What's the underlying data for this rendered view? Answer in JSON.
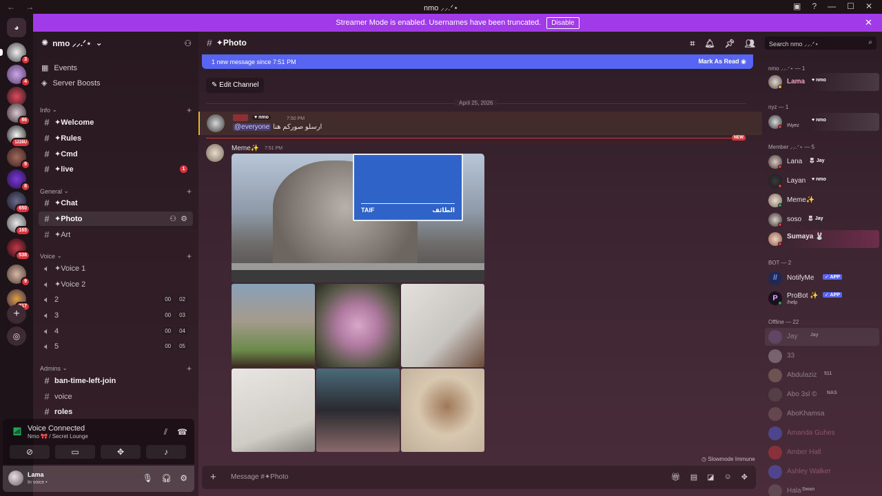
{
  "window": {
    "title": "nmo ⸝⸝.ᐟ⋆",
    "nav_arrows": "← →"
  },
  "streamer_banner": {
    "text": "Streamer Mode is enabled. Usernames have been truncated.",
    "button": "Disable"
  },
  "guilds": {
    "badges": [
      "3",
      "4",
      "86",
      "1228U",
      "9",
      "8",
      "650",
      "165",
      "538",
      "9",
      "217"
    ]
  },
  "server": {
    "name": "nmo ⸝⸝.ᐟ⋆",
    "top_items": [
      {
        "label": "Events"
      },
      {
        "label": "Server Boosts"
      }
    ],
    "categories": [
      {
        "name": "Info",
        "channels": [
          {
            "name": "✦Welcome"
          },
          {
            "name": "✦Rules"
          },
          {
            "name": "✦Cmd"
          },
          {
            "name": "✦live",
            "mention": "1"
          }
        ]
      },
      {
        "name": "General",
        "channels": [
          {
            "name": "✦Chat"
          },
          {
            "name": "✦Photo"
          },
          {
            "name": "✦Art"
          }
        ]
      },
      {
        "name": "Voice",
        "channels": [
          {
            "name": "✦Voice 1"
          },
          {
            "name": "✦Voice 2"
          },
          {
            "name": "2",
            "a": "00",
            "b": "02"
          },
          {
            "name": "3",
            "a": "00",
            "b": "03"
          },
          {
            "name": "4",
            "a": "00",
            "b": "04"
          },
          {
            "name": "5",
            "a": "00",
            "b": "05"
          }
        ]
      },
      {
        "name": "Admins",
        "channels": [
          {
            "name": "ban-time-left-join"
          },
          {
            "name": "voice"
          },
          {
            "name": "roles"
          }
        ]
      }
    ]
  },
  "voice_panel": {
    "title": "Voice Connected",
    "subtitle": "Nmo 🎀 / Secret Lounge"
  },
  "user_panel": {
    "name": "Lama",
    "status": "In voice •"
  },
  "channel": {
    "name": "✦Photo",
    "new_messages": "1 new message since 7:51 PM",
    "mark_read": "Mark As Read",
    "edit_channel": "Edit Channel",
    "date_divider": "April 25, 2026",
    "new_label": "NEW",
    "slowmode": "Slowmode Immune",
    "composer_placeholder": "Message #✦Photo"
  },
  "messages": [
    {
      "tag": "nmo",
      "time": "7:50 PM",
      "mention": "@everyone",
      "text": "ارسلو صوركم هنا"
    },
    {
      "author": "Meme✨",
      "time": "7:51 PM",
      "sign_left": "TAIF",
      "sign_right": "الطائف"
    }
  ],
  "search": {
    "placeholder": "Search nmo ⸝⸝.ᐟ⋆"
  },
  "member_groups": [
    {
      "label": "nmo ⸝⸝.ᐟ⋆ — 1"
    },
    {
      "label": "nyz — 1"
    },
    {
      "label": "Member ⸝⸝.ᐟ⋆ — 5"
    },
    {
      "label": "BOT — 2"
    },
    {
      "label": "Offline — 22"
    }
  ],
  "members": [
    {
      "name": "Lama",
      "tag": "nmo"
    },
    {
      "name": "",
      "tag": "nmo",
      "sub": "INyez"
    },
    {
      "name": "Lana",
      "tag": "Jay"
    },
    {
      "name": "Layan",
      "tag": "nmo"
    },
    {
      "name": "Meme✨",
      "tag": ""
    },
    {
      "name": "soso",
      "tag": "Jay"
    },
    {
      "name": "Sumaya 🐰",
      "tag": ""
    },
    {
      "name": "NotifyMe",
      "tag": "✓ APP"
    },
    {
      "name": "ProBot ✨",
      "tag": "✓ APP",
      "sub": "/help"
    },
    {
      "name": "Jay",
      "tag": "Jay"
    },
    {
      "name": "33",
      "tag": ""
    },
    {
      "name": "Abdulaziz",
      "tag": "511"
    },
    {
      "name": "Abo 3sl ©",
      "tag": "NAS"
    },
    {
      "name": "AboKhamsa",
      "tag": ""
    },
    {
      "name": "Amanda Guhes",
      "tag": ""
    },
    {
      "name": "Amber Hall",
      "tag": ""
    },
    {
      "name": "Ashley Walker",
      "tag": ""
    },
    {
      "name": "Hala",
      "tag": "Swan"
    }
  ],
  "colors": {
    "accent": "#5865f2",
    "banner": "#a13ae8",
    "mention_red": "#da373c",
    "online": "#23a559",
    "mention_highlight": "#f0b232"
  }
}
